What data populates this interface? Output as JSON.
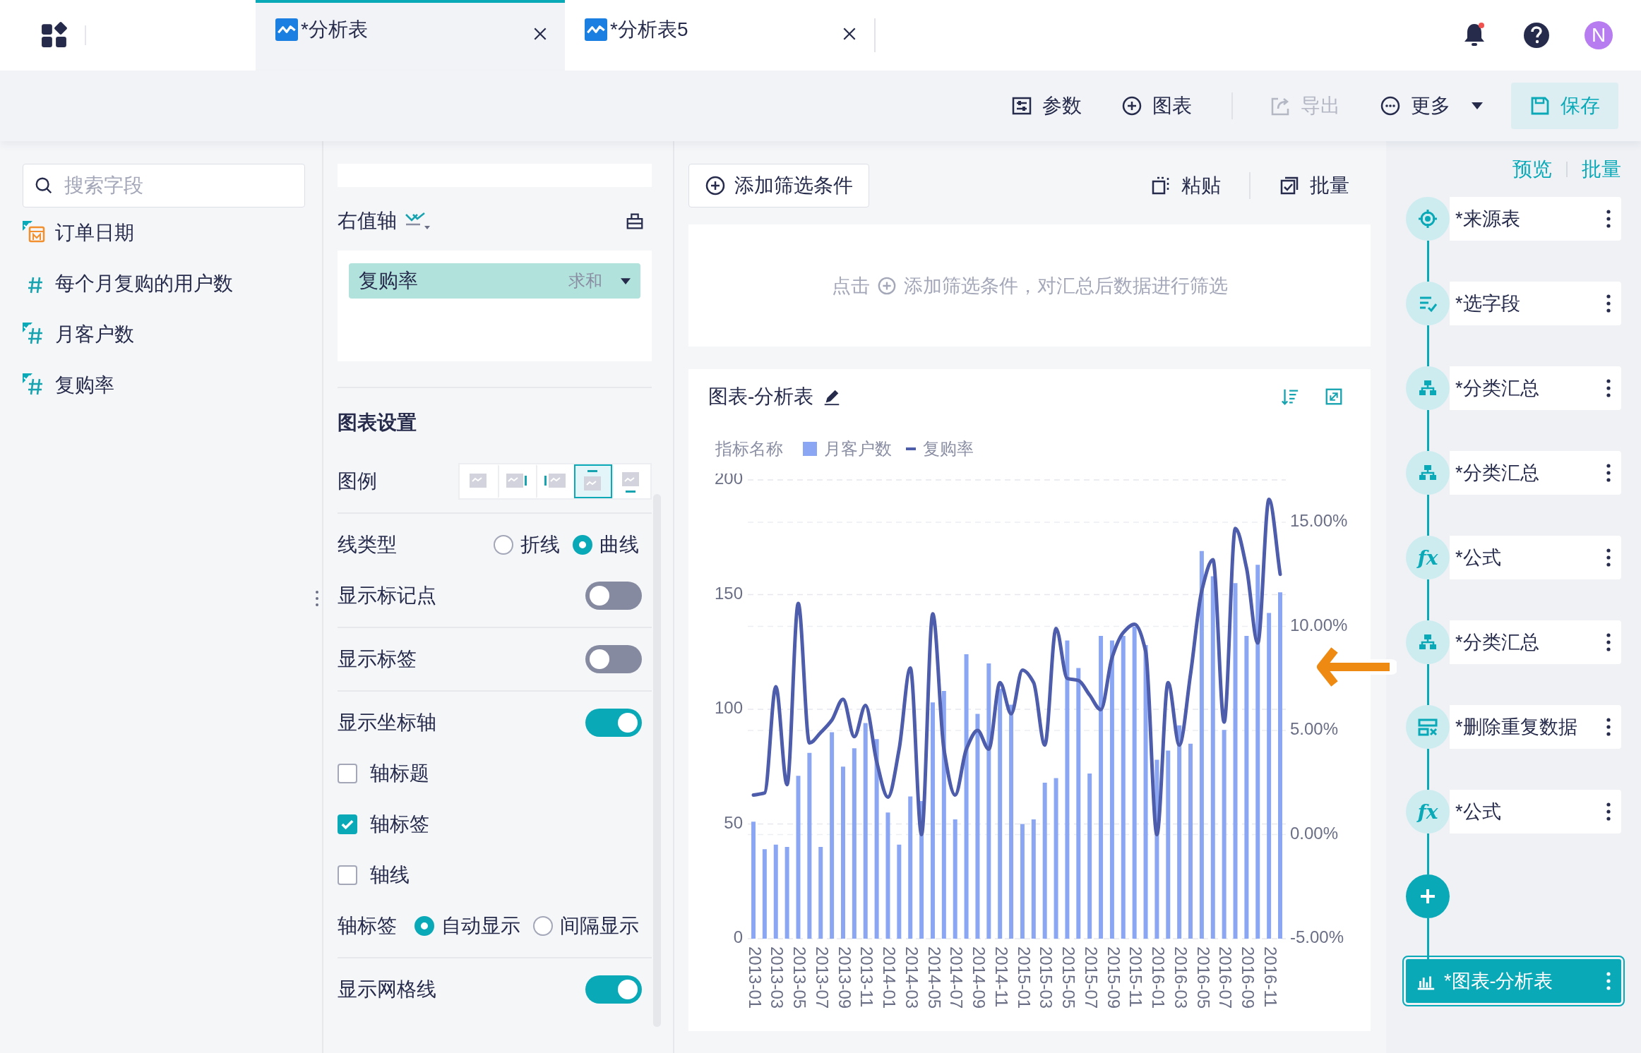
{
  "topbar": {
    "tabs": [
      {
        "title": "*分析表",
        "selected": true
      },
      {
        "title": "*分析表5",
        "selected": false
      }
    ],
    "notification": true,
    "avatar": "N"
  },
  "toolbar": {
    "items": [
      {
        "kind": "params",
        "label": "参数",
        "disabled": false
      },
      {
        "kind": "chart",
        "label": "图表",
        "disabled": false
      },
      {
        "kind": "export",
        "label": "导出",
        "disabled": true
      },
      {
        "kind": "more",
        "label": "更多",
        "disabled": false
      }
    ],
    "save": "保存"
  },
  "fields": {
    "search_placeholder": "搜索字段",
    "items": [
      {
        "kind": "date",
        "label": "订单日期",
        "marked": true
      },
      {
        "kind": "number",
        "label": "每个月复购的用户数",
        "marked": false
      },
      {
        "kind": "number",
        "label": "月客户数",
        "marked": true
      },
      {
        "kind": "number",
        "label": "复购率",
        "marked": true
      }
    ]
  },
  "config": {
    "right_axis": {
      "label": "右值轴",
      "fields": [
        {
          "name": "复购率",
          "aggregation": "求和"
        }
      ]
    },
    "settings_title": "图表设置",
    "sections": [
      [
        {
          "kind": "legend",
          "label": "图例",
          "options": [
            {
              "kind": "none",
              "selected": false
            },
            {
              "kind": "right",
              "selected": false
            },
            {
              "kind": "left",
              "selected": false
            },
            {
              "kind": "top",
              "selected": true
            },
            {
              "kind": "bottom",
              "selected": false
            }
          ]
        }
      ],
      [
        {
          "kind": "radio",
          "label": "线类型",
          "options": [
            {
              "label": "折线",
              "selected": false
            },
            {
              "label": "曲线",
              "selected": true
            }
          ]
        },
        {
          "kind": "toggle",
          "label": "显示标记点",
          "on": false
        }
      ],
      [
        {
          "kind": "toggle",
          "label": "显示标签",
          "on": false
        }
      ],
      [
        {
          "kind": "toggle",
          "label": "显示坐标轴",
          "on": true
        },
        {
          "kind": "checkbox",
          "label": "轴标题",
          "checked": false
        },
        {
          "kind": "checkbox",
          "label": "轴标签",
          "checked": true
        },
        {
          "kind": "checkbox",
          "label": "轴线",
          "checked": false
        },
        {
          "kind": "radio",
          "label": "轴标签",
          "options": [
            {
              "label": "自动显示",
              "selected": true
            },
            {
              "label": "间隔显示",
              "selected": false
            }
          ]
        }
      ],
      [
        {
          "kind": "toggle",
          "label": "显示网格线",
          "on": true
        }
      ]
    ]
  },
  "filter": {
    "add_label": "添加筛选条件",
    "actions": [
      {
        "kind": "paste",
        "label": "粘贴"
      },
      {
        "kind": "batch",
        "label": "批量"
      }
    ],
    "hint_before": "点击",
    "hint_after": "添加筛选条件，对汇总后数据进行筛选"
  },
  "chart_card": {
    "title": "图表-分析表",
    "legend_title": "指标名称",
    "chart_data": {
      "type": "bar",
      "categories": [
        "2013-01",
        null,
        "2013-03",
        null,
        "2013-05",
        null,
        "2013-07",
        null,
        "2013-09",
        null,
        "2013-11",
        null,
        "2014-01",
        null,
        "2014-03",
        null,
        "2014-05",
        null,
        "2014-07",
        null,
        "2014-09",
        null,
        "2014-11",
        null,
        "2015-01",
        null,
        "2015-03",
        null,
        "2015-05",
        null,
        "2015-07",
        null,
        "2015-09",
        null,
        "2015-11",
        null,
        "2016-01",
        null,
        "2016-03",
        null,
        "2016-05",
        null,
        "2016-07",
        null,
        "2016-09",
        null,
        "2016-11",
        null
      ],
      "series": [
        {
          "name": "月客户数",
          "color": "#8ba7f3",
          "values": [
            51,
            39,
            41,
            40,
            71,
            81,
            40,
            90,
            75,
            83,
            94,
            87,
            55,
            41,
            62,
            60,
            103,
            108,
            52,
            124,
            98,
            120,
            109,
            102,
            50,
            52,
            68,
            70,
            130,
            118,
            72,
            132,
            130,
            132,
            136,
            128,
            78,
            82,
            93,
            85,
            169,
            158,
            91,
            155,
            132,
            163,
            142,
            151
          ]
        },
        {
          "name": "复购率",
          "type": "line",
          "axis": "y2",
          "color": "#4d5cab",
          "values": [
            1.9,
            2.0,
            7.1,
            2.4,
            11.1,
            4.4,
            4.9,
            5.5,
            6.5,
            4.7,
            6.2,
            3.5,
            1.8,
            4.1,
            8.0,
            0.0,
            10.6,
            4.1,
            1.9,
            4.1,
            5.0,
            4.1,
            7.3,
            5.8,
            7.9,
            7.3,
            4.3,
            9.9,
            7.5,
            7.4,
            6.7,
            6.0,
            8.5,
            9.7,
            10.1,
            8.8,
            0.0,
            7.3,
            4.3,
            7.7,
            11.7,
            13.2,
            5.4,
            14.7,
            12.8,
            9.2,
            16.1,
            12.5
          ]
        }
      ],
      "grid": true,
      "ylim": [
        0,
        200
      ],
      "yticks": [
        0,
        50,
        100,
        150,
        200
      ],
      "y2lim": [
        -5,
        17
      ],
      "y2ticks": [
        {
          "value": -5,
          "label": "-5.00%"
        },
        {
          "value": 0,
          "label": "0.00%"
        },
        {
          "value": 5,
          "label": "5.00%"
        },
        {
          "value": 10,
          "label": "10.00%"
        },
        {
          "value": 15,
          "label": "15.00%"
        }
      ]
    }
  },
  "pipeline": {
    "links": [
      "预览",
      "批量"
    ],
    "nodes": [
      {
        "kind": "source",
        "label": "*来源表",
        "selected": false
      },
      {
        "kind": "select",
        "label": "*选字段",
        "selected": false
      },
      {
        "kind": "group",
        "label": "*分类汇总",
        "selected": false
      },
      {
        "kind": "group",
        "label": "*分类汇总",
        "selected": false
      },
      {
        "kind": "formula",
        "label": "*公式",
        "icon_text": "fx",
        "selected": false
      },
      {
        "kind": "group",
        "label": "*分类汇总",
        "selected": false
      },
      {
        "kind": "dedupe",
        "label": "*删除重复数据",
        "selected": false
      },
      {
        "kind": "formula",
        "label": "*公式",
        "icon_text": "fx",
        "selected": false
      },
      {
        "kind": "add"
      },
      {
        "kind": "chart",
        "label": "*图表-分析表",
        "selected": true
      }
    ]
  }
}
